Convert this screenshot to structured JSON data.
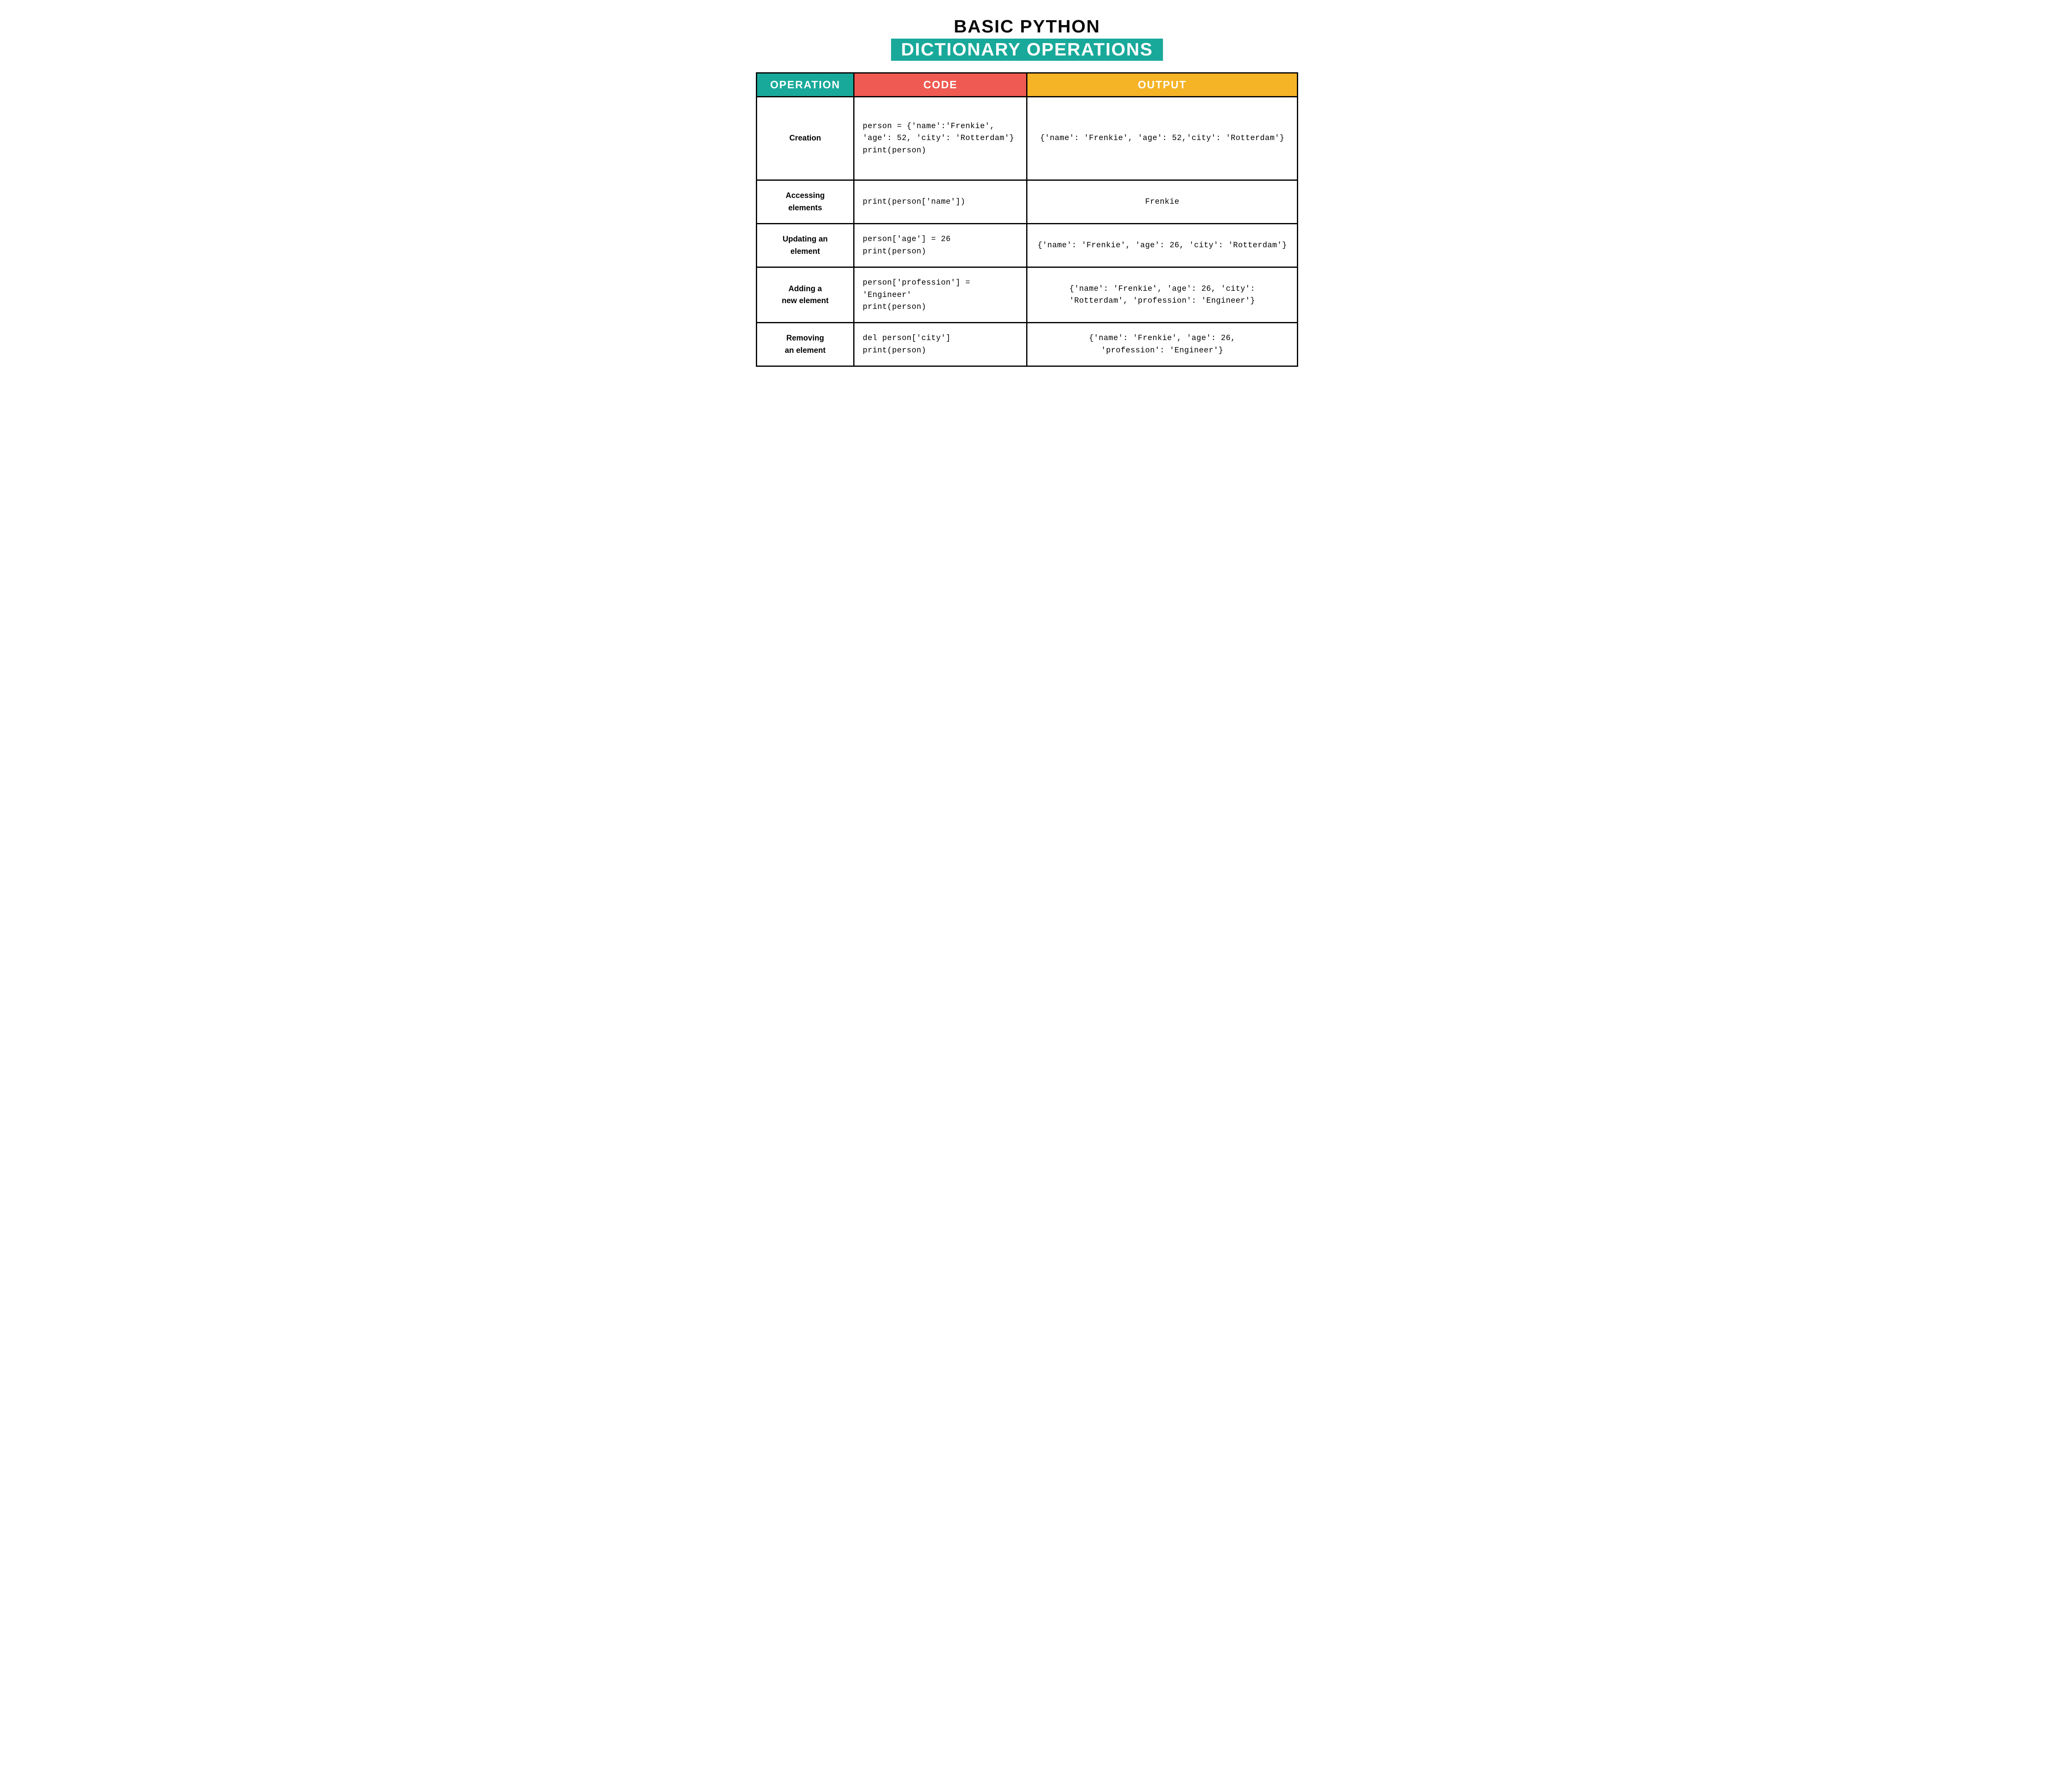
{
  "title": {
    "line1": "BASIC PYTHON",
    "line2": "DICTIONARY OPERATIONS"
  },
  "headers": {
    "operation": "OPERATION",
    "code": "CODE",
    "output": "OUTPUT"
  },
  "rows": [
    {
      "operation": "Creation",
      "code": "person = {'name':'Frenkie',\n'age': 52, 'city': 'Rotterdam'}\nprint(person)",
      "output": "{'name': 'Frenkie', 'age': 52,'city': 'Rotterdam'}"
    },
    {
      "operation": "Accessing\nelements",
      "code": "print(person['name'])",
      "output": "Frenkie"
    },
    {
      "operation": "Updating an\nelement",
      "code": "person['age'] = 26\nprint(person)",
      "output": "{'name': 'Frenkie', 'age': 26, 'city': 'Rotterdam'}"
    },
    {
      "operation": "Adding a\nnew element",
      "code": "person['profession'] = 'Engineer'\nprint(person)",
      "output": "{'name': 'Frenkie', 'age': 26, 'city':\n'Rotterdam', 'profession': 'Engineer'}"
    },
    {
      "operation": "Removing\nan element",
      "code": "del person['city']\nprint(person)",
      "output": "{'name': 'Frenkie', 'age': 26,\n'profession': 'Engineer'}"
    }
  ]
}
